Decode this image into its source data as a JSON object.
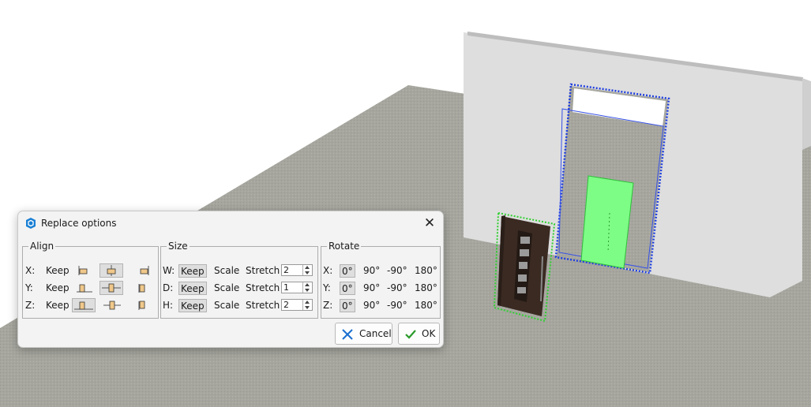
{
  "dialog": {
    "title": "Replace options",
    "icons": {
      "app": "app-shield-icon",
      "close": "close-icon"
    }
  },
  "align": {
    "label": "Align",
    "rows": [
      {
        "axis": "X:",
        "keep": "Keep",
        "selected": "center",
        "icons": [
          "align-left-icon",
          "align-center-icon",
          "align-right-icon"
        ]
      },
      {
        "axis": "Y:",
        "keep": "Keep",
        "selected": "center",
        "icons": [
          "align-front-icon",
          "align-middle-icon",
          "align-back-icon"
        ]
      },
      {
        "axis": "Z:",
        "keep": "Keep",
        "selected": "bottom",
        "icons": [
          "align-bottom-icon",
          "align-middle-icon",
          "align-top-icon"
        ]
      }
    ]
  },
  "size": {
    "label": "Size",
    "rows": [
      {
        "axis": "W:",
        "keep": "Keep",
        "scale": "Scale",
        "stretch": "Stretch",
        "value": "2",
        "selected": "Keep"
      },
      {
        "axis": "D:",
        "keep": "Keep",
        "scale": "Scale",
        "stretch": "Stretch",
        "value": "1",
        "selected": "Keep"
      },
      {
        "axis": "H:",
        "keep": "Keep",
        "scale": "Scale",
        "stretch": "Stretch",
        "value": "2",
        "selected": "Keep"
      }
    ]
  },
  "rotate": {
    "label": "Rotate",
    "rows": [
      {
        "axis": "X:",
        "options": [
          "0°",
          "90°",
          "-90°",
          "180°"
        ],
        "selected": "0°"
      },
      {
        "axis": "Y:",
        "options": [
          "0°",
          "90°",
          "-90°",
          "180°"
        ],
        "selected": "0°"
      },
      {
        "axis": "Z:",
        "options": [
          "0°",
          "90°",
          "-90°",
          "180°"
        ],
        "selected": "0°"
      }
    ]
  },
  "buttons": {
    "cancel": "Cancel",
    "ok": "OK"
  },
  "colors": {
    "accent": "#1a7fd4",
    "selection_blue": "#1f3fe0",
    "selection_green": "#2fd02f",
    "highlight_fill": "#7dfc86",
    "door": "#3a2a22",
    "floor": "#a4a49d",
    "wall": "#dcdcdc"
  }
}
